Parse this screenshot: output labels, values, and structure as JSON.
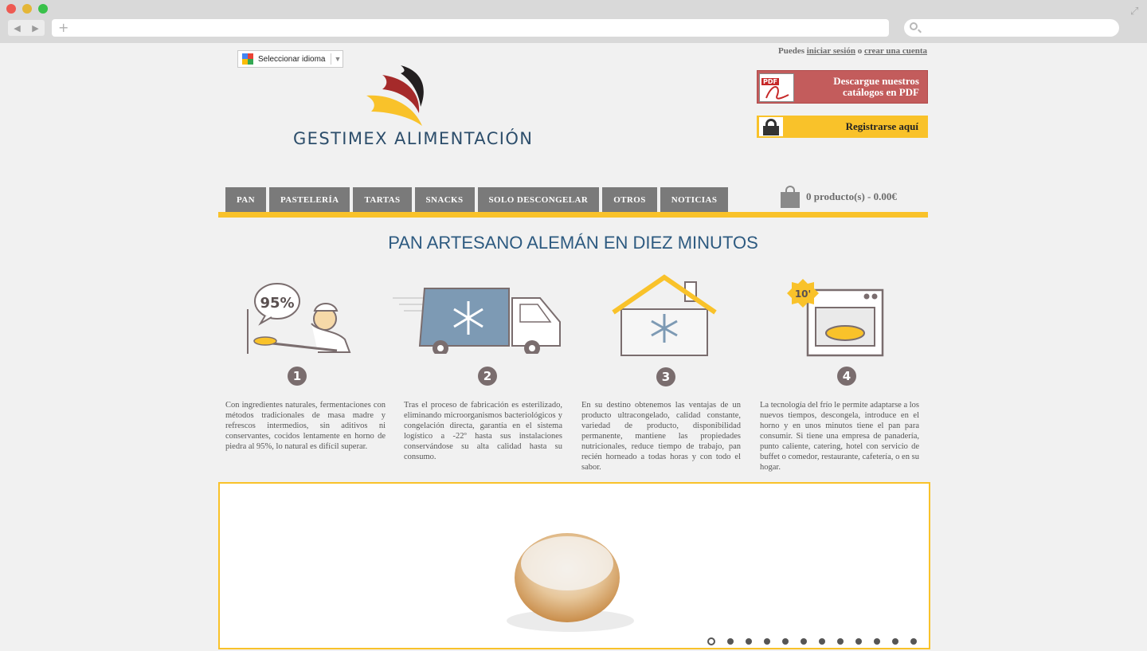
{
  "browser": {
    "back": "◀",
    "forward": "▶",
    "new_tab": "+"
  },
  "language": {
    "label": "Seleccionar idioma",
    "arrow": "▼"
  },
  "account": {
    "prefix": "Puedes",
    "login": "iniciar sesión",
    "middle": "o",
    "register": "crear una cuenta"
  },
  "logo": {
    "text": "GESTIMEX ALIMENTACIÓN",
    "colors": [
      "#231f20",
      "#a52a2a",
      "#f9c22a"
    ]
  },
  "pdf_button": {
    "icon_label": "PDF",
    "label": "Descargue nuestros catálogos en PDF"
  },
  "register_button": {
    "label": "Registrarse aquí"
  },
  "menu": [
    "PAN",
    "PASTELERÍA",
    "TARTAS",
    "SNACKS",
    "SOLO DESCONGELAR",
    "OTROS",
    "NOTICIAS"
  ],
  "cart": {
    "label": "0 producto(s) - 0.00€"
  },
  "headline": "PAN ARTESANO ALEMÁN EN DIEZ MINUTOS",
  "steps": [
    {
      "number": "1",
      "badge": "95%",
      "text": "Con ingredientes naturales, fermentaciones con métodos tradicionales de masa madre y refrescos intermedios, sin aditivos ni conservantes, cocidos lentamente en horno de piedra al 95%, lo natural es difícil superar."
    },
    {
      "number": "2",
      "text": "Tras el proceso de fabricación es esterilizado, eliminando microorganismos bacteriológicos y congelación directa, garantía en el sistema logístico a -22º hasta sus instalaciones conservándose su alta calidad hasta su consumo."
    },
    {
      "number": "3",
      "text": "En su destino obtenemos las ventajas de un producto ultracongelado, calidad constante, variedad de producto, disponibilidad permanente, mantiene las propiedades nutricionales, reduce tiempo de trabajo, pan recién horneado a todas horas y con todo el sabor."
    },
    {
      "number": "4",
      "badge": "10'",
      "text": "La tecnología del frío le permite adaptarse a los nuevos tiempos, descongela, introduce en el horno y en unos minutos tiene el pan para consumir. Si tiene una empresa de panadería, punto caliente, catering, hotel con servicio de buffet o comedor, restaurante, cafetería, o en su hogar."
    }
  ],
  "slider": {
    "slide_count": 12,
    "active_index": 0
  },
  "colors": {
    "accent": "#f9c22a",
    "menu": "#7a7a7a",
    "pdf": "#c35c5c",
    "headline": "#2d5a80",
    "step_badge": "#7a6d6e"
  }
}
